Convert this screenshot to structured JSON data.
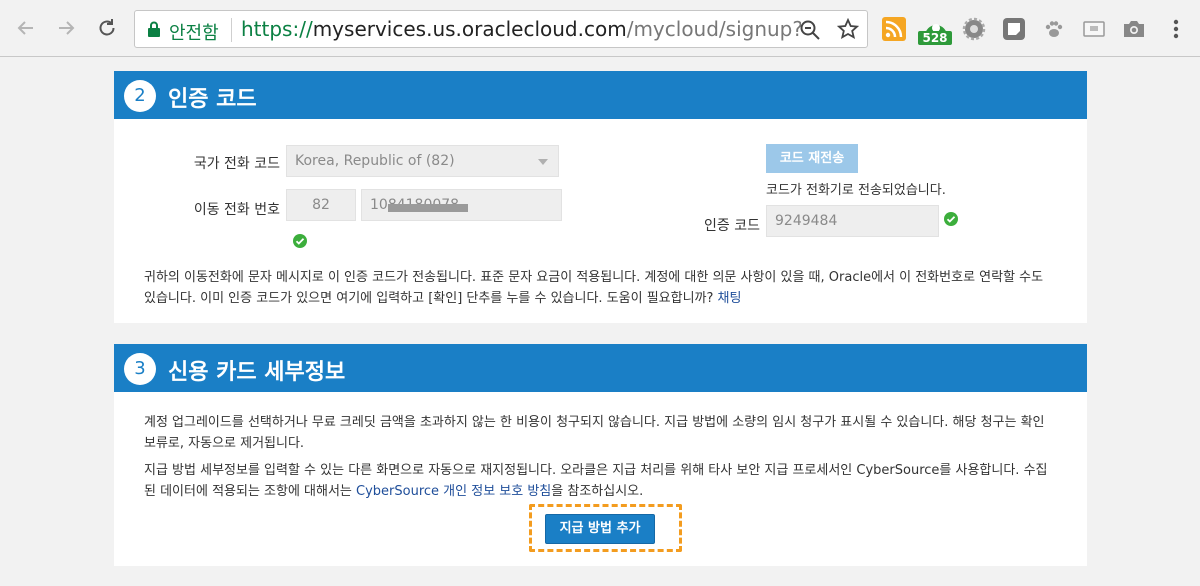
{
  "browser": {
    "secure_label": "안전함",
    "url_protocol": "https://",
    "url_host": "myservices.us.oraclecloud.com",
    "url_path": "/mycloud/signup?l...",
    "extension_badge_count": "528",
    "icons": [
      "back-arrow-icon",
      "forward-arrow-icon",
      "reload-icon",
      "lock-icon",
      "zoom-icon",
      "star-icon",
      "rss-icon",
      "badge-extension-icon",
      "gear-icon",
      "note-icon",
      "paw-icon",
      "box-icon",
      "camera-icon",
      "menu-icon"
    ]
  },
  "verification": {
    "step_number": "2",
    "title": "인증 코드",
    "country_label": "국가 전화 코드",
    "country_value": "Korea, Republic of (82)",
    "mobile_label": "이동 전화 번호",
    "mobile_prefix": "82",
    "mobile_number": "1084180078",
    "resend_button": "코드 재전송",
    "sent_message": "코드가 전화기로 전송되었습니다.",
    "code_label": "인증 코드",
    "code_value": "9249484",
    "info_text": "귀하의 이동전화에 문자 메시지로 이 인증 코드가 전송됩니다. 표준 문자 요금이 적용됩니다. 계정에 대한 의문 사항이 있을 때, Oracle에서 이 전화번호로 연락할 수도 있습니다. 이미 인증 코드가 있으면 여기에 입력하고 [확인] 단추를 누를 수 있습니다. 도움이 필요합니까?",
    "chat_link": "채팅"
  },
  "credit_card": {
    "step_number": "3",
    "title": "신용 카드 세부정보",
    "paragraph1": "계정 업그레이드를 선택하거나 무료 크레딧 금액을 초과하지 않는 한 비용이 청구되지 않습니다. 지급 방법에 소량의 임시 청구가 표시될 수 있습니다. 해당 청구는 확인 보류로, 자동으로 제거됩니다.",
    "paragraph2_before": "지급 방법 세부정보를 입력할 수 있는 다른 화면으로 자동으로 재지정됩니다. 오라클은 지급 처리를 위해 타사 보안 지급 프로세서인 CyberSource를 사용합니다. 수집된 데이터에 적용되는 조항에 대해서는",
    "privacy_link": "CyberSource 개인 정보 보호 방침",
    "paragraph2_after": "을 참조하십시오.",
    "add_payment_button": "지급 방법 추가"
  },
  "colors": {
    "header_blue": "#1a7fc6",
    "highlight_orange": "#f39c1f",
    "secure_green": "#0b8043",
    "check_green": "#3cae3c"
  }
}
